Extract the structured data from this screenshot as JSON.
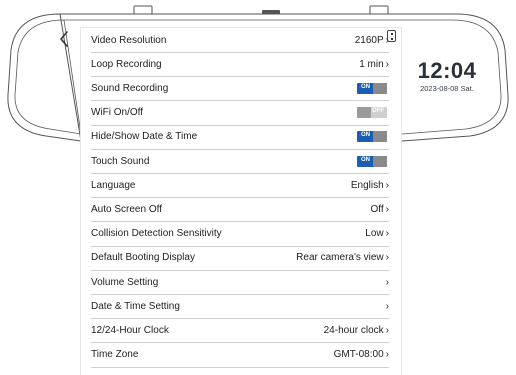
{
  "clock": {
    "time": "12:04",
    "date": "2023-08-08 Sat."
  },
  "settings": [
    {
      "label": "Video Resolution",
      "value": "2160P",
      "type": "select"
    },
    {
      "label": "Loop Recording",
      "value": "1 min",
      "type": "select"
    },
    {
      "label": "Sound Recording",
      "type": "toggle",
      "state": "ON",
      "on": true
    },
    {
      "label": "WiFi On/Off",
      "type": "toggle",
      "state": "OFF",
      "on": false
    },
    {
      "label": "Hide/Show Date & Time",
      "type": "toggle",
      "state": "ON",
      "on": true
    },
    {
      "label": "Touch Sound",
      "type": "toggle",
      "state": "ON",
      "on": true
    },
    {
      "label": "Language",
      "value": "English",
      "type": "select"
    },
    {
      "label": "Auto Screen Off",
      "value": "Off",
      "type": "select"
    },
    {
      "label": "Collision Detection Sensitivity",
      "value": "Low",
      "type": "select"
    },
    {
      "label": "Default Booting Display",
      "value": "Rear camera's view",
      "type": "select"
    },
    {
      "label": "Volume Setting",
      "value": "",
      "type": "select"
    },
    {
      "label": "Date & Time Setting",
      "value": "",
      "type": "select"
    },
    {
      "label": "12/24-Hour Clock",
      "value": "24-hour clock",
      "type": "select"
    },
    {
      "label": "Time Zone",
      "value": "GMT-08:00",
      "type": "select"
    }
  ],
  "colors": {
    "toggle_on": "#1a5fb4",
    "toggle_off": "#cfcfcf",
    "knob": "#8a8a8a"
  }
}
